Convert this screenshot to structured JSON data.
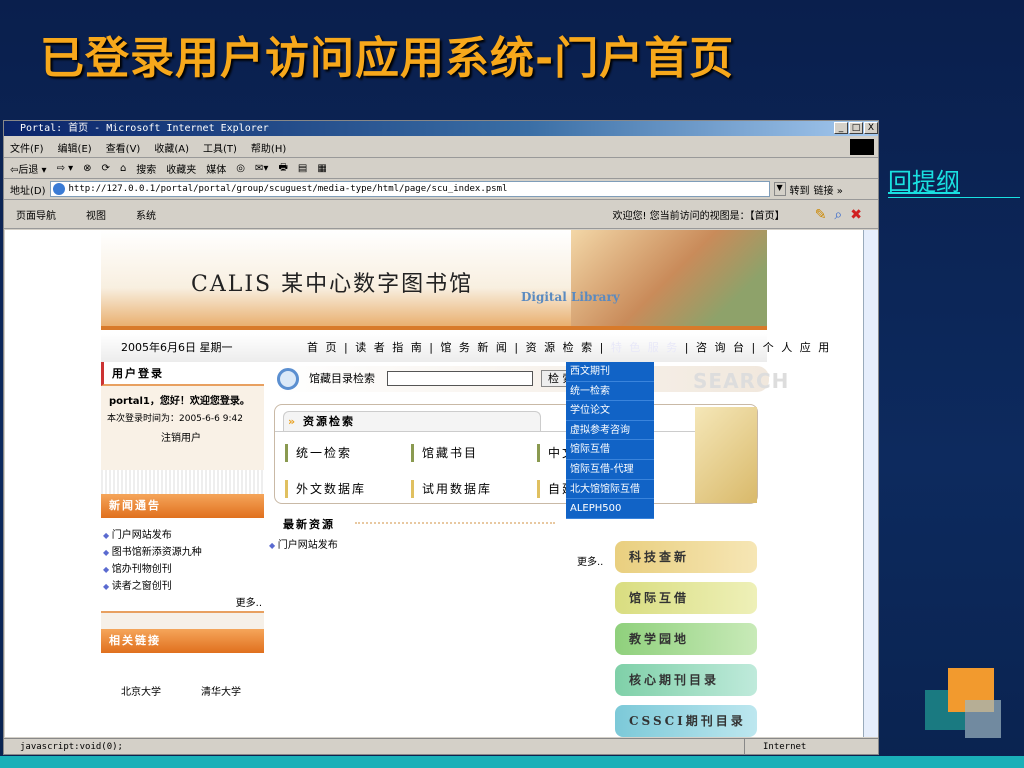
{
  "slide": {
    "title": "已登录用户访问应用系统-门户首页",
    "back_link": "回提纲"
  },
  "browser": {
    "title": "Portal: 首页 - Microsoft Internet Explorer",
    "window_buttons": [
      "_",
      "□",
      "X"
    ],
    "menu": [
      "文件(F)",
      "编辑(E)",
      "查看(V)",
      "收藏(A)",
      "工具(T)",
      "帮助(H)"
    ],
    "toolbar": [
      "⇦后退 ▾",
      "⇨ ▾",
      "⊗",
      "⟳",
      "⌂",
      "搜索",
      "收藏夹",
      "媒体",
      "◎",
      "✉▾",
      "🖶",
      "▤",
      "▦"
    ],
    "address_label": "地址(D)",
    "address": "http://127.0.0.1/portal/portal/group/scuguest/media-type/html/page/scu_index.psml",
    "go": "转到",
    "links": "链接 »",
    "status": "javascript:void(0);",
    "zone": "Internet"
  },
  "portal_toolbar": {
    "items": [
      "页面导航",
      "视图",
      "系统"
    ],
    "welcome": "欢迎您! 您当前访问的视图是：【首页】"
  },
  "banner": {
    "title": "CALIS 某中心数字图书馆",
    "subtitle": "Digital Library"
  },
  "navrow": {
    "date": "2005年6月6日 星期一",
    "items": [
      "首 页",
      "读 者 指 南",
      "馆 务 新 闻",
      "资 源 检 索",
      "特 色 服 务",
      "咨 询 台",
      "个 人 应 用"
    ]
  },
  "login": {
    "title": "用户登录",
    "greeting": "portal1，您好！欢迎您登录。",
    "time": "本次登录时间为：2005-6-6 9:42",
    "logout": "注销用户"
  },
  "news": {
    "title": "新闻通告",
    "items": [
      "门户网站发布",
      "图书馆新添资源九种",
      "馆办刊物创刊",
      "读者之窗创刊"
    ],
    "more": "更多.."
  },
  "links": {
    "title": "相关链接",
    "items": [
      "北京大学",
      "清华大学"
    ]
  },
  "search": {
    "label": "馆藏目录检索",
    "value": "",
    "button": "检 索"
  },
  "resources": {
    "title": "资源检索",
    "items": [
      "统一检索",
      "馆藏书目",
      "中文",
      "外文数据库",
      "试用数据库",
      "自建"
    ]
  },
  "dropdown": [
    "西文期刊",
    "统一检索",
    "学位论文",
    "虚拟参考咨询",
    "馆际互借",
    "馆际互借-代理",
    "北大馆馆际互借",
    "ALEPH500"
  ],
  "latest": {
    "title": "最新资源",
    "items": [
      "门户网站发布"
    ],
    "more": "更多.."
  },
  "side_buttons": [
    {
      "label": "科技查新",
      "color": "#e9cf7f"
    },
    {
      "label": "馆际互借",
      "color": "#d9dd80"
    },
    {
      "label": "教学园地",
      "color": "#8fd07c"
    },
    {
      "label": "核心期刊目录",
      "color": "#7fd0a8"
    },
    {
      "label": "CSSCI期刊目录",
      "color": "#7cc9d8"
    }
  ],
  "colors": {
    "title": "#f7a81b",
    "link": "#19e0e0",
    "accent": "#e0701e",
    "dropdown": "#1163c6"
  }
}
